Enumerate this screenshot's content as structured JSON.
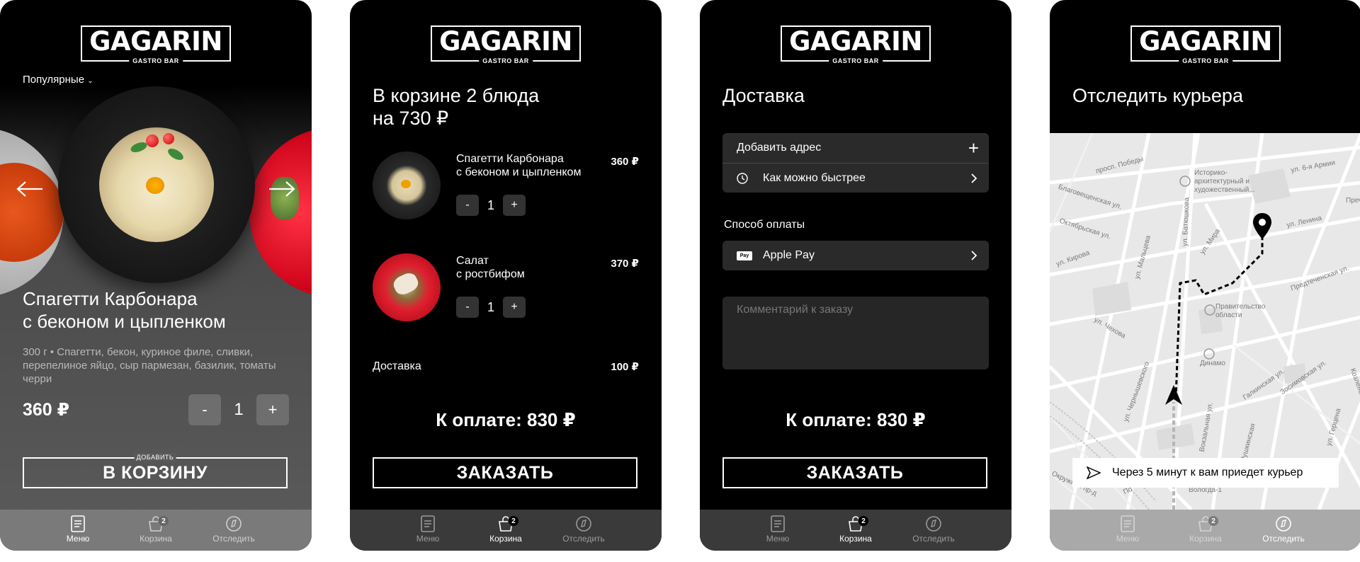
{
  "brand": {
    "name": "GAGARIN",
    "tagline": "GASTRO BAR"
  },
  "tabs": {
    "menu": "Меню",
    "cart": "Корзина",
    "track": "Отследить",
    "cart_badge": "2"
  },
  "menu_screen": {
    "filter": "Популярные",
    "dish_title_line1": "Спагетти Карбонара",
    "dish_title_line2": "с беконом и цыпленком",
    "dish_desc": "300 г • Спагетти, бекон, куриное филе, сливки, перепелиное яйцо, сыр пармезан, базилик, томаты черри",
    "price": "360 ₽",
    "qty_minus": "-",
    "qty": "1",
    "qty_plus": "+",
    "cta_over": "ДОБАВИТЬ",
    "cta": "В КОРЗИНУ"
  },
  "cart_screen": {
    "title_line1": "В корзине 2 блюда",
    "title_line2": "на 730 ₽",
    "items": [
      {
        "name_line1": "Спагетти Карбонара",
        "name_line2": "с беконом и цыпленком",
        "price": "360 ₽",
        "qty": "1"
      },
      {
        "name_line1": "Салат",
        "name_line2": "с ростбифом",
        "price": "370 ₽",
        "qty": "1"
      }
    ],
    "minus": "-",
    "plus": "+",
    "delivery_label": "Доставка",
    "delivery_price": "100 ₽",
    "total": "К оплате: 830 ₽",
    "cta": "ЗАКАЗАТЬ"
  },
  "delivery_screen": {
    "title": "Доставка",
    "add_address": "Добавить адрес",
    "plus": "+",
    "time": "Как можно быстрее",
    "payment_label": "Способ оплаты",
    "pay_badge": "Pay",
    "payment_method": "Apple Pay",
    "comment_placeholder": "Комментарий к заказу",
    "total": "К оплате: 830 ₽",
    "cta": "ЗАКАЗАТЬ"
  },
  "track_screen": {
    "title": "Отследить курьера",
    "map_labels": {
      "pobedy": "просп. Победы",
      "museum": "Историко-\nархитектурный и\nхудожественный...",
      "kirova_6a": "ул. 6-я Армии",
      "prech": "Пречи",
      "blago": "Благовещенская ул.",
      "okt": "Октябрьская ул.",
      "kirova": "ул. Кирова",
      "malceva": "ул. Мальцева",
      "batyushkova": "ул. Батюшкова",
      "mira": "ул. Мира",
      "lenina": "ул. Ленина",
      "pred": "Предтеченская ул.",
      "pravitelstvo": "Правительство\nобласти",
      "chekhova": "ул. Чехова",
      "dinamo": "Динамо",
      "galkinskaya": "Галкинская ул.",
      "zosimovskaya": "Зосимовская ул.",
      "kozlenskaya": "Козленская ул.",
      "chernyshevskogo": "ул. Чернышевского",
      "gertsena": "ул. Герцена",
      "vokzal": "Вокзальная ул.",
      "vologda": "Вологда-1",
      "pushkinskaya": "ул. Пушкинская",
      "okruzhnaya": "Окружной пр-д",
      "po": "По"
    },
    "courier_message": "Через 5 минут к вам приедет курьер"
  }
}
